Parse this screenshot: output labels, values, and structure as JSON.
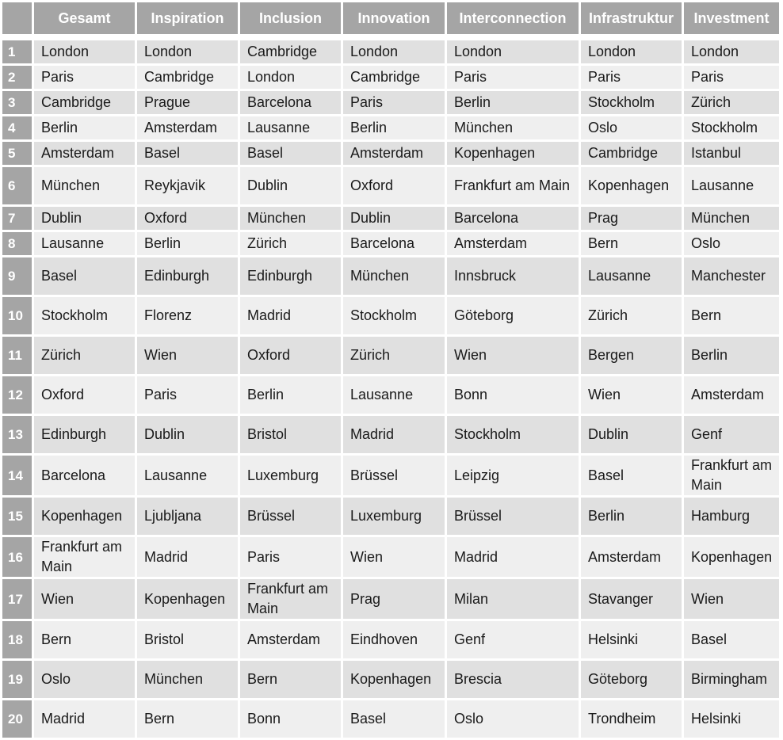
{
  "table": {
    "headers": [
      "",
      "Gesamt",
      "Inspiration",
      "Inclusion",
      "Innovation",
      "Interconnection",
      "Infrastruktur",
      "Investment"
    ],
    "rows": [
      {
        "rank": "1",
        "cells": [
          "London",
          "London",
          "Cambridge",
          "London",
          "London",
          "London",
          "London"
        ]
      },
      {
        "rank": "2",
        "cells": [
          "Paris",
          "Cambridge",
          "London",
          "Cambridge",
          "Paris",
          "Paris",
          "Paris"
        ]
      },
      {
        "rank": "3",
        "cells": [
          "Cambridge",
          "Prague",
          "Barcelona",
          "Paris",
          "Berlin",
          "Stockholm",
          "Zürich"
        ]
      },
      {
        "rank": "4",
        "cells": [
          "Berlin",
          "Amsterdam",
          "Lausanne",
          "Berlin",
          "München",
          "Oslo",
          "Stockholm"
        ]
      },
      {
        "rank": "5",
        "cells": [
          "Amsterdam",
          "Basel",
          "Basel",
          "Amsterdam",
          "Kopenhagen",
          "Cambridge",
          "Istanbul"
        ]
      },
      {
        "rank": "6",
        "cells": [
          "München",
          "Reykjavik",
          "Dublin",
          "Oxford",
          "Frankfurt am Main",
          "Kopenhagen",
          "Lausanne"
        ]
      },
      {
        "rank": "7",
        "cells": [
          "Dublin",
          "Oxford",
          "München",
          "Dublin",
          "Barcelona",
          "Prag",
          "München"
        ]
      },
      {
        "rank": "8",
        "cells": [
          "Lausanne",
          "Berlin",
          "Zürich",
          "Barcelona",
          "Amsterdam",
          "Bern",
          "Oslo"
        ]
      },
      {
        "rank": "9",
        "cells": [
          "Basel",
          "Edinburgh",
          "Edinburgh",
          "München",
          "Innsbruck",
          "Lausanne",
          "Manchester"
        ]
      },
      {
        "rank": "10",
        "cells": [
          "Stockholm",
          "Florenz",
          "Madrid",
          "Stockholm",
          "Göteborg",
          "Zürich",
          "Bern"
        ]
      },
      {
        "rank": "11",
        "cells": [
          "Zürich",
          "Wien",
          "Oxford",
          "Zürich",
          "Wien",
          "Bergen",
          "Berlin"
        ]
      },
      {
        "rank": "12",
        "cells": [
          "Oxford",
          "Paris",
          "Berlin",
          "Lausanne",
          "Bonn",
          "Wien",
          "Amsterdam"
        ]
      },
      {
        "rank": "13",
        "cells": [
          "Edinburgh",
          "Dublin",
          "Bristol",
          "Madrid",
          "Stockholm",
          "Dublin",
          "Genf"
        ]
      },
      {
        "rank": "14",
        "cells": [
          "Barcelona",
          "Lausanne",
          "Luxemburg",
          "Brüssel",
          "Leipzig",
          "Basel",
          "Frankfurt am Main"
        ]
      },
      {
        "rank": "15",
        "cells": [
          "Kopenhagen",
          "Ljubljana",
          "Brüssel",
          "Luxemburg",
          "Brüssel",
          "Berlin",
          "Hamburg"
        ]
      },
      {
        "rank": "16",
        "cells": [
          "Frankfurt am Main",
          "Madrid",
          "Paris",
          "Wien",
          "Madrid",
          "Amsterdam",
          "Kopenhagen"
        ]
      },
      {
        "rank": "17",
        "cells": [
          "Wien",
          "Kopenhagen",
          "Frankfurt am Main",
          "Prag",
          "Milan",
          "Stavanger",
          "Wien"
        ]
      },
      {
        "rank": "18",
        "cells": [
          "Bern",
          "Bristol",
          "Amsterdam",
          "Eindhoven",
          "Genf",
          "Helsinki",
          "Basel"
        ]
      },
      {
        "rank": "19",
        "cells": [
          "Oslo",
          "München",
          "Bern",
          "Kopenhagen",
          "Brescia",
          "Göteborg",
          "Birmingham"
        ]
      },
      {
        "rank": "20",
        "cells": [
          "Madrid",
          "Bern",
          "Bonn",
          "Basel",
          "Oslo",
          "Trondheim",
          "Helsinki"
        ]
      }
    ]
  },
  "colors": {
    "header_bg": "#a5a5a5",
    "header_text": "#ffffff",
    "row_odd_bg": "#e0e0e0",
    "row_even_bg": "#efefef"
  }
}
